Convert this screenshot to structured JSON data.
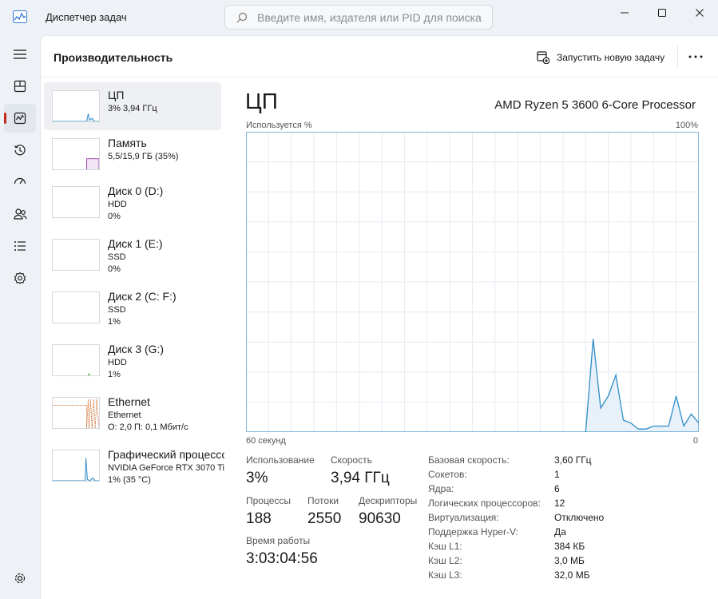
{
  "app": {
    "title": "Диспетчер задач",
    "search_placeholder": "Введите имя, издателя или PID для поиска"
  },
  "nav": {
    "items": [
      {
        "icon": "hamburger-icon"
      },
      {
        "icon": "processes-icon"
      },
      {
        "icon": "performance-icon",
        "active": true
      },
      {
        "icon": "app-history-icon"
      },
      {
        "icon": "startup-apps-icon"
      },
      {
        "icon": "users-icon"
      },
      {
        "icon": "details-icon"
      },
      {
        "icon": "services-icon"
      }
    ],
    "settings_icon": "settings-gear-icon"
  },
  "header": {
    "title": "Производительность",
    "run_task_label": "Запустить новую задачу"
  },
  "devices": [
    {
      "name": "ЦП",
      "line1": "3% 3,94 ГГц",
      "line2": "",
      "color": "#2f8dc8"
    },
    {
      "name": "Память",
      "line1": "5,5/15,9 ГБ (35%)",
      "line2": "",
      "color": "#9a3ea8"
    },
    {
      "name": "Диск 0 (D:)",
      "line1": "HDD",
      "line2": "0%",
      "color": "#58a33a"
    },
    {
      "name": "Диск 1 (E:)",
      "line1": "SSD",
      "line2": "0%",
      "color": "#58a33a"
    },
    {
      "name": "Диск 2 (C: F:)",
      "line1": "SSD",
      "line2": "1%",
      "color": "#58a33a"
    },
    {
      "name": "Диск 3 (G:)",
      "line1": "HDD",
      "line2": "1%",
      "color": "#58a33a"
    },
    {
      "name": "Ethernet",
      "line1": "Ethernet",
      "line2": "О: 2,0  П: 0,1 Мбит/с",
      "color": "#c8621e"
    },
    {
      "name": "Графический процессор 0",
      "line1": "NVIDIA GeForce RTX 3070 Ti",
      "line2": "1% (35 °C)",
      "color": "#2f8dc8"
    }
  ],
  "cpu": {
    "title": "ЦП",
    "processor": "AMD Ryzen 5 3600 6-Core Processor",
    "graph_label": "Используется %",
    "graph_max": "100%",
    "graph_time": "60 секунд",
    "graph_min": "0",
    "accent": "#2f8dc8"
  },
  "chart_data": {
    "type": "area",
    "ylim": [
      0,
      100
    ],
    "x": [
      0,
      1,
      2,
      3,
      4,
      5,
      6,
      7,
      8,
      9,
      10,
      11,
      12,
      13,
      14,
      15,
      16,
      17,
      18,
      19,
      20,
      21,
      22,
      23,
      24,
      25,
      26,
      27,
      28,
      29,
      30,
      31,
      32,
      33,
      34,
      35,
      36,
      37,
      38,
      39,
      40,
      41,
      42,
      43,
      44,
      45,
      46,
      47,
      48,
      49,
      50,
      51,
      52,
      53,
      54,
      55,
      56,
      57,
      58,
      59,
      60
    ],
    "values": [
      0,
      0,
      0,
      0,
      0,
      0,
      0,
      0,
      0,
      0,
      0,
      0,
      0,
      0,
      0,
      0,
      0,
      0,
      0,
      0,
      0,
      0,
      0,
      0,
      0,
      0,
      0,
      0,
      0,
      0,
      0,
      0,
      0,
      0,
      0,
      0,
      0,
      0,
      0,
      0,
      0,
      0,
      0,
      0,
      0,
      0,
      31,
      8,
      12,
      19,
      4,
      3,
      1,
      1,
      2,
      2,
      2,
      12,
      2,
      6,
      3
    ]
  },
  "stats": {
    "utilization_label": "Использование",
    "utilization_value": "3%",
    "speed_label": "Скорость",
    "speed_value": "3,94 ГГц",
    "processes_label": "Процессы",
    "processes_value": "188",
    "threads_label": "Потоки",
    "threads_value": "2550",
    "handles_label": "Дескрипторы",
    "handles_value": "90630",
    "uptime_label": "Время работы",
    "uptime_value": "3:03:04:56"
  },
  "specs": [
    {
      "label": "Базовая скорость:",
      "value": "3,60 ГГц"
    },
    {
      "label": "Сокетов:",
      "value": "1"
    },
    {
      "label": "Ядра:",
      "value": "6"
    },
    {
      "label": "Логических процессоров:",
      "value": "12"
    },
    {
      "label": "Виртуализация:",
      "value": "Отключено"
    },
    {
      "label": "Поддержка Hyper-V:",
      "value": "Да"
    },
    {
      "label": "Кэш L1:",
      "value": "384 КБ"
    },
    {
      "label": "Кэш L2:",
      "value": "3,0 МБ"
    },
    {
      "label": "Кэш L3:",
      "value": "32,0 МБ"
    }
  ]
}
